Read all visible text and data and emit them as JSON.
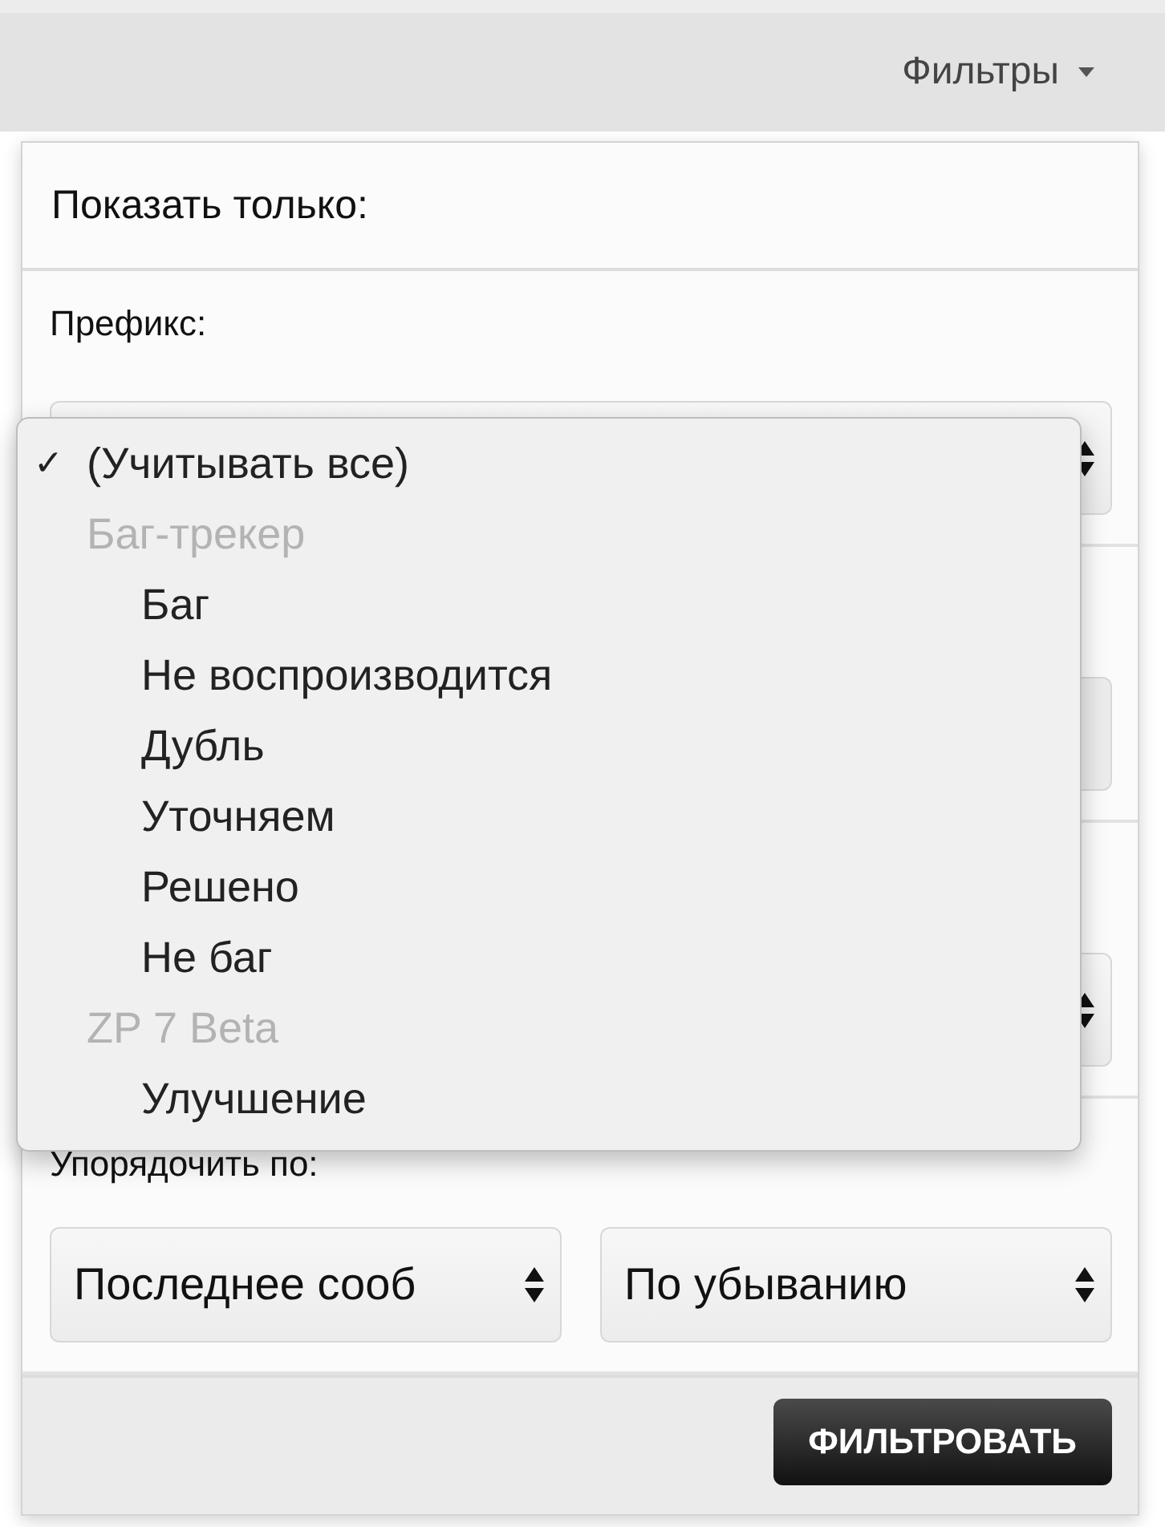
{
  "toolbar": {
    "filters_button": "Фильтры"
  },
  "panel": {
    "title": "Показать только:",
    "fields": [
      {
        "kind": "select",
        "label": "Префикс:"
      },
      {
        "kind": "input"
      },
      {
        "kind": "select"
      }
    ],
    "sort": {
      "label": "Упорядочить по:",
      "field": "Последнее сооб",
      "order": "По убыванию"
    },
    "submit": "ФИЛЬТРОВАТЬ"
  },
  "dropdown": {
    "check_mark": "✓",
    "options": [
      {
        "kind": "option",
        "label": "(Учитывать все)",
        "selected": true
      },
      {
        "kind": "group",
        "label": "Баг-трекер",
        "children": [
          {
            "kind": "option",
            "label": "Баг",
            "selected": false
          },
          {
            "kind": "option",
            "label": "Не воспроизводится",
            "selected": false
          },
          {
            "kind": "option",
            "label": "Дубль",
            "selected": false
          },
          {
            "kind": "option",
            "label": "Уточняем",
            "selected": false
          },
          {
            "kind": "option",
            "label": "Решено",
            "selected": false
          },
          {
            "kind": "option",
            "label": "Не баг",
            "selected": false
          }
        ]
      },
      {
        "kind": "group",
        "label": "ZP 7 Beta",
        "children": [
          {
            "kind": "option",
            "label": "Улучшение",
            "selected": false
          }
        ]
      }
    ]
  }
}
